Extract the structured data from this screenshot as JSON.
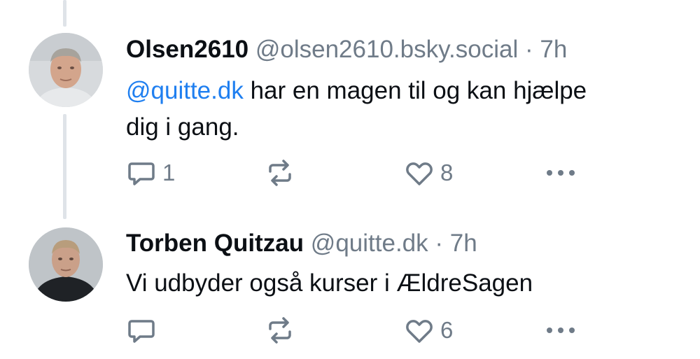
{
  "posts": [
    {
      "author": "Olsen2610",
      "handle": "@olsen2610.bsky.social",
      "separator": "·",
      "time": "7h",
      "mention": "@quitte.dk",
      "text_line1": " har en magen til og kan hjælpe",
      "text_line2": "dig i gang.",
      "reply_count": "1",
      "repost_count": "",
      "like_count": "8"
    },
    {
      "author": "Torben Quitzau",
      "handle": "@quitte.dk",
      "separator": "·",
      "time": "7h",
      "text": "Vi udbyder også kurser i ÆldreSagen",
      "reply_count": "",
      "repost_count": "",
      "like_count": "6"
    }
  ],
  "icons": {
    "reply": "reply-icon",
    "repost": "repost-icon",
    "like": "heart-icon",
    "more": "more-icon"
  },
  "colors": {
    "mention": "#1f7ff0",
    "muted": "#6f7b88",
    "thread_line": "#dfe3e8"
  }
}
